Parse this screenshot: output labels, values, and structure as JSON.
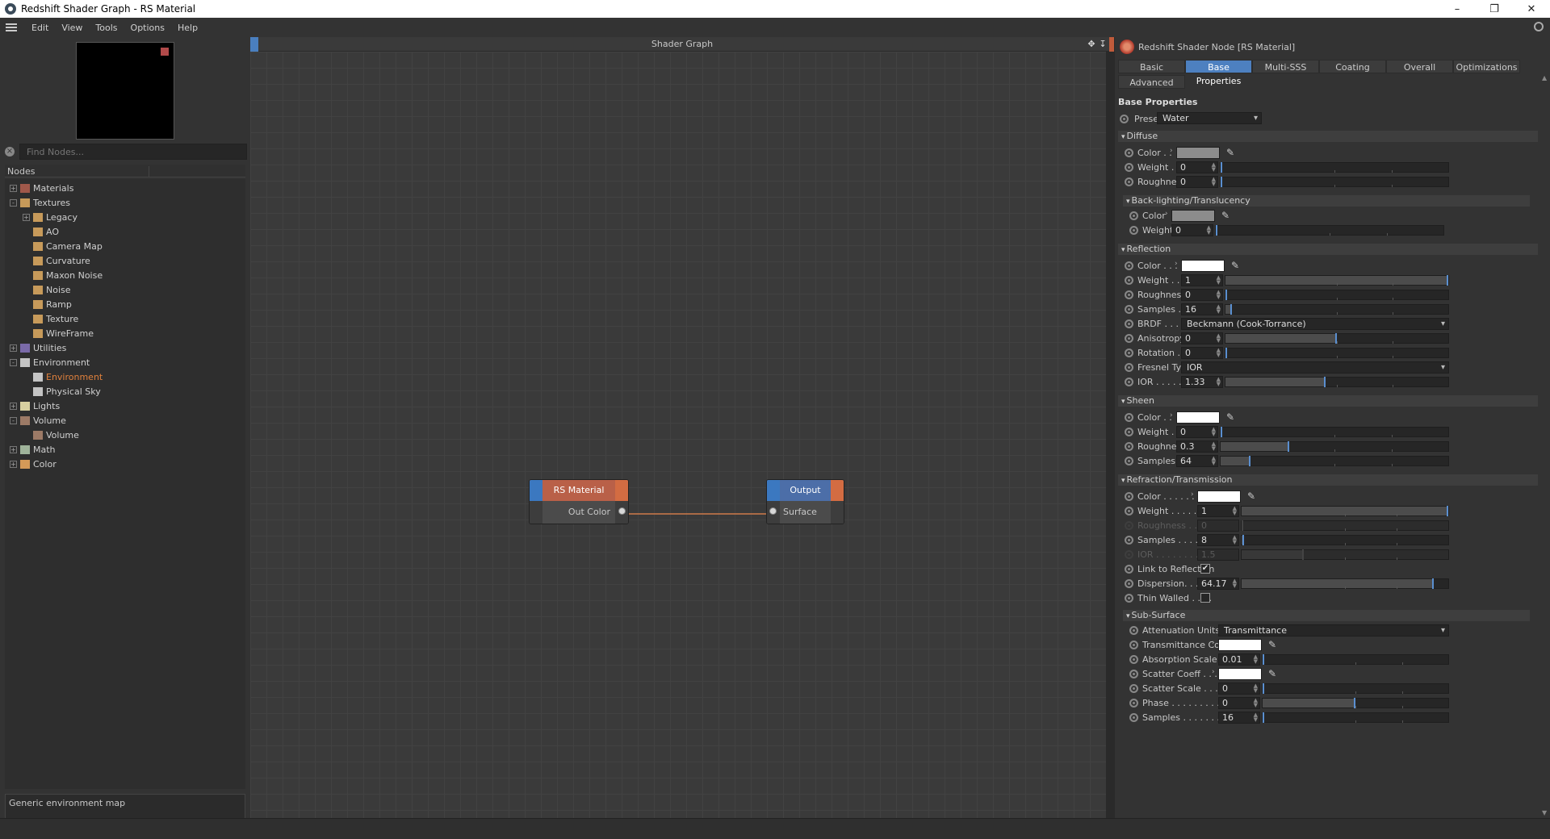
{
  "window": {
    "title": "Redshift Shader Graph - RS Material"
  },
  "menu": [
    "Edit",
    "View",
    "Tools",
    "Options",
    "Help"
  ],
  "left": {
    "find_placeholder": "Find Nodes...",
    "nodes_header": "Nodes",
    "tree": [
      {
        "label": "Materials",
        "depth": 0,
        "expander": "+",
        "color": "#a0584a"
      },
      {
        "label": "Textures",
        "depth": 0,
        "expander": "-",
        "color": "#c79a5a"
      },
      {
        "label": "Legacy",
        "depth": 1,
        "expander": "+",
        "color": "#c79a5a"
      },
      {
        "label": "AO",
        "depth": 1,
        "expander": "",
        "color": "#c79a5a"
      },
      {
        "label": "Camera Map",
        "depth": 1,
        "expander": "",
        "color": "#c79a5a"
      },
      {
        "label": "Curvature",
        "depth": 1,
        "expander": "",
        "color": "#c79a5a"
      },
      {
        "label": "Maxon Noise",
        "depth": 1,
        "expander": "",
        "color": "#c79a5a"
      },
      {
        "label": "Noise",
        "depth": 1,
        "expander": "",
        "color": "#c79a5a"
      },
      {
        "label": "Ramp",
        "depth": 1,
        "expander": "",
        "color": "#c79a5a"
      },
      {
        "label": "Texture",
        "depth": 1,
        "expander": "",
        "color": "#c79a5a"
      },
      {
        "label": "WireFrame",
        "depth": 1,
        "expander": "",
        "color": "#c79a5a"
      },
      {
        "label": "Utilities",
        "depth": 0,
        "expander": "+",
        "color": "#7a6aa8"
      },
      {
        "label": "Environment",
        "depth": 0,
        "expander": "-",
        "color": "#c4c4c4"
      },
      {
        "label": "Environment",
        "depth": 1,
        "expander": "",
        "color": "#c4c4c4",
        "selected": true
      },
      {
        "label": "Physical Sky",
        "depth": 1,
        "expander": "",
        "color": "#c4c4c4"
      },
      {
        "label": "Lights",
        "depth": 0,
        "expander": "+",
        "color": "#d8d0a0"
      },
      {
        "label": "Volume",
        "depth": 0,
        "expander": "-",
        "color": "#9c7a66"
      },
      {
        "label": "Volume",
        "depth": 1,
        "expander": "",
        "color": "#9c7a66"
      },
      {
        "label": "Math",
        "depth": 0,
        "expander": "+",
        "color": "#9fb39a"
      },
      {
        "label": "Color",
        "depth": 0,
        "expander": "+",
        "color": "#d49a58"
      }
    ],
    "description": "Generic environment map"
  },
  "graph": {
    "title": "Shader Graph",
    "nodes": [
      {
        "title": "RS Material",
        "port": "Out Color"
      },
      {
        "title": "Output",
        "port": "Surface"
      }
    ]
  },
  "right": {
    "header": "Redshift Shader Node [RS Material]",
    "tabs": [
      "Basic",
      "Base Properties",
      "Multi-SSS",
      "Coating",
      "Overall",
      "Optimizations",
      "Advanced"
    ],
    "active_tab": "Base Properties",
    "section_title": "Base Properties",
    "preset_label": "Preset",
    "preset_value": "Water",
    "groups": {
      "diffuse": "Diffuse",
      "backlighting": "Back-lighting/Translucency",
      "reflection": "Reflection",
      "sheen": "Sheen",
      "refraction": "Refraction/Transmission",
      "subsurface": "Sub-Surface"
    },
    "labels": {
      "diff_color": "Color . .",
      "diff_weight": "Weight . .",
      "diff_roughness": "Roughness",
      "bl_color": "Color",
      "bl_weight": "Weight",
      "refl_color": "Color . . .",
      "refl_weight": "Weight . .",
      "refl_roughness": "Roughness",
      "refl_samples": "Samples . .",
      "refl_brdf": "BRDF . . . .",
      "refl_aniso": "Anisotropy",
      "refl_rotation": "Rotation . .",
      "refl_fresnel": "Fresnel Type",
      "refl_ior": "IOR . . . . .",
      "sheen_color": "Color . .",
      "sheen_weight": "Weight . .",
      "sheen_roughness": "Roughness",
      "sheen_samples": "Samples .",
      "refr_color": "Color . . . . . .",
      "refr_weight": "Weight . . . . . .",
      "refr_roughness": "Roughness . . . .",
      "refr_samples": "Samples . . . . . .",
      "refr_ior": "IOR . . . . . . . . .",
      "refr_link": "Link to Reflection",
      "refr_dispersion": "Dispersion. . . . .",
      "refr_thin": "Thin Walled . . . .",
      "ss_atten": "Attenuation Units . . .",
      "ss_trans_color": "Transmittance Color",
      "ss_abs_scale": "Absorption Scale . . . .",
      "ss_scatter_coeff": "Scatter Coeff . . . .",
      "ss_scatter_scale": "Scatter Scale . . . . . .",
      "ss_phase": "Phase . . . . . . . . . . .",
      "ss_samples": "Samples . . . . . . . . ."
    },
    "values": {
      "diff_weight": "0",
      "diff_roughness": "0",
      "bl_weight": "0",
      "refl_weight": "1",
      "refl_roughness": "0",
      "refl_samples": "16",
      "refl_brdf": "Beckmann (Cook-Torrance)",
      "refl_aniso": "0",
      "refl_rotation": "0",
      "refl_fresnel": "IOR",
      "refl_ior": "1.33",
      "sheen_weight": "0",
      "sheen_roughness": "0.3",
      "sheen_samples": "64",
      "refr_weight": "1",
      "refr_roughness": "0",
      "refr_samples": "8",
      "refr_ior": "1.5",
      "refr_dispersion": "64.17",
      "ss_atten": "Transmittance",
      "ss_abs_scale": "0.01",
      "ss_scatter_scale": "0",
      "ss_phase": "0",
      "ss_samples": "16"
    },
    "colors": {
      "diffuse": "#8c8c8c",
      "backlight": "#8c8c8c",
      "reflection": "#ffffff",
      "sheen": "#ffffff",
      "refraction": "#ffffff",
      "transmittance": "#ffffff",
      "scatter": "#ffffff",
      "accent": "#4d80c0"
    },
    "slider_levels": {
      "diff_weight": 0,
      "diff_roughness": 0,
      "bl_weight": 0,
      "refl_weight": 1,
      "refl_roughness": 0,
      "refl_samples": 0.03,
      "refl_aniso": 0.5,
      "refl_rotation": 0,
      "refl_ior": 0.45,
      "sheen_weight": 0,
      "sheen_roughness": 0.3,
      "sheen_samples": 0.13,
      "refr_weight": 1,
      "refr_roughness": 0,
      "refr_samples": 0.01,
      "refr_ior": 0.3,
      "refr_dispersion": 0.93,
      "ss_abs_scale": 0,
      "ss_scatter_scale": 0,
      "ss_phase": 0.5,
      "ss_samples": 0
    },
    "checkboxes": {
      "link_to_reflection": true,
      "thin_walled": false
    }
  }
}
